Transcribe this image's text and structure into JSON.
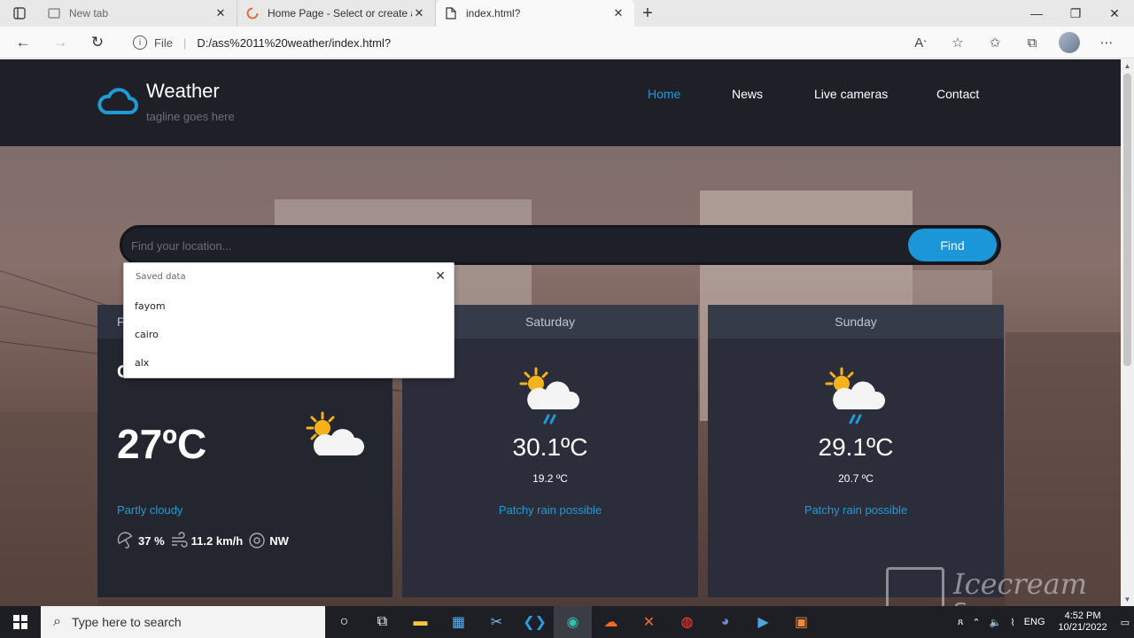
{
  "browser": {
    "tabs": [
      {
        "title": "New tab",
        "icon": "new-tab-icon"
      },
      {
        "title": "Home Page - Select or create a n",
        "icon": "loading-spinner-icon"
      },
      {
        "title": "index.html?",
        "icon": "file-icon"
      }
    ],
    "address": {
      "scheme_label": "File",
      "url": "D:/ass%2011%20weather/index.html?"
    }
  },
  "site": {
    "title": "Weather",
    "tagline": "tagline goes here",
    "nav": [
      {
        "label": "Home",
        "active": true
      },
      {
        "label": "News",
        "active": false
      },
      {
        "label": "Live cameras",
        "active": false
      },
      {
        "label": "Contact",
        "active": false
      }
    ],
    "search": {
      "placeholder": "Find your location...",
      "button": "Find"
    },
    "autocomplete": {
      "title": "Saved data",
      "items": [
        "fayom",
        "cairo",
        "alx"
      ]
    },
    "today": {
      "day_label": "F",
      "city": "Cairo",
      "temp": "27ºC",
      "condition": "Partly cloudy",
      "humidity": "37 %",
      "wind_speed": "11.2 km/h",
      "wind_dir": "NW"
    },
    "forecast": [
      {
        "day": "Saturday",
        "max": "30.1ºC",
        "min": "19.2 ºC",
        "condition": "Patchy rain possible"
      },
      {
        "day": "Sunday",
        "max": "29.1ºC",
        "min": "20.7 ºC",
        "condition": "Patchy rain possible"
      }
    ]
  },
  "watermark": {
    "line1": "Icecream",
    "line2": "Screen Recorder"
  },
  "taskbar": {
    "search_placeholder": "Type here to search",
    "language": "ENG",
    "time": "4:52 PM",
    "date": "10/21/2022"
  },
  "colors": {
    "accent": "#1f9bd8",
    "header_bg": "#1f2027",
    "card_bg": "#2b2d3a"
  }
}
